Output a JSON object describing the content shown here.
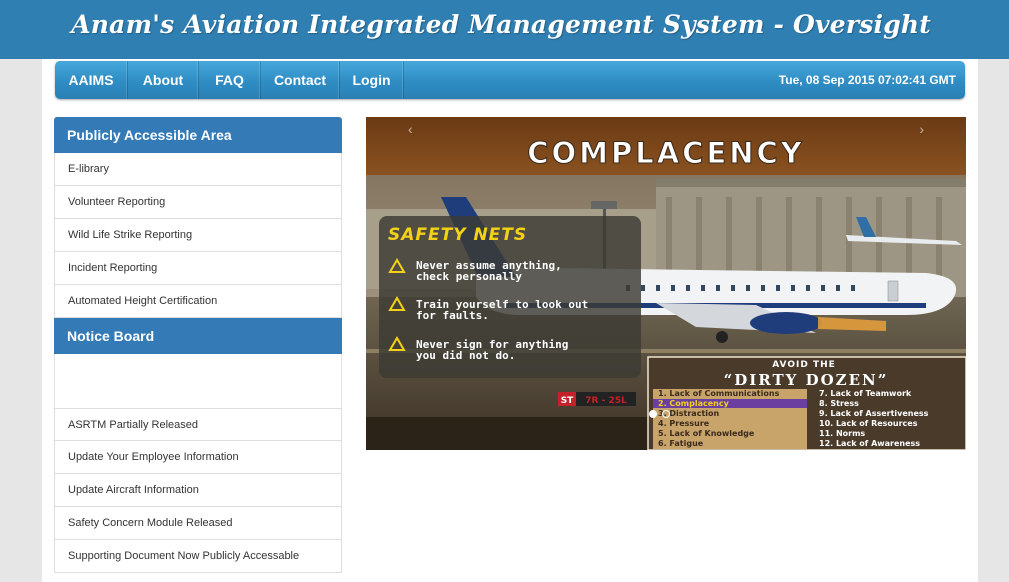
{
  "header": {
    "title": "Anam's Aviation Integrated Management System - Oversight"
  },
  "nav": {
    "items": [
      "AAIMS",
      "About",
      "FAQ",
      "Contact",
      "Login"
    ],
    "datetime": "Tue, 08 Sep 2015 07:02:41 GMT"
  },
  "sidebar": {
    "public_title": "Publicly Accessible Area",
    "public_items": [
      "E-library",
      "Volunteer Reporting",
      "Wild Life Strike Reporting",
      "Incident Reporting",
      "Automated Height Certification"
    ],
    "notice_title": "Notice Board",
    "notice_items": [
      "ASRTM Partially Released",
      "Update Your Employee Information",
      "Update Aircraft Information",
      "Safety Concern Module Released",
      "Supporting Document Now Publicly Accessable"
    ]
  },
  "carousel": {
    "prev_icon": "chevron-left-icon",
    "next_icon": "chevron-right-icon",
    "slide": {
      "title": "COMPLACENCY",
      "box_title": "SAFETY NETS",
      "nets": [
        [
          "Never assume anything,",
          "check personally"
        ],
        [
          "Train yourself to look out",
          "for faults."
        ],
        [
          "Never sign for anything",
          "you did not do."
        ]
      ],
      "runway_sign_st": "ST",
      "runway_sign": "7R - 25L",
      "avoid_label": "AVOID THE",
      "dozen_title": "“DIRTY DOZEN”",
      "dozen_left": [
        "1.  Lack of Communications",
        "2.  Complacency",
        "3.  Distraction",
        "4.  Pressure",
        "5.  Lack of Knowledge",
        "6.  Fatigue"
      ],
      "dozen_right": [
        "7.  Lack of Teamwork",
        "8.  Stress",
        "9.  Lack of Assertiveness",
        "10. Lack of Resources",
        "11. Norms",
        "12. Lack of Awareness"
      ]
    },
    "active_slide": 1,
    "slide_count": 2
  },
  "colors": {
    "header": "#2f7fb3",
    "nav": "#2f8dc4",
    "panel": "#337ab7",
    "slide_yellow": "#f5d214"
  }
}
